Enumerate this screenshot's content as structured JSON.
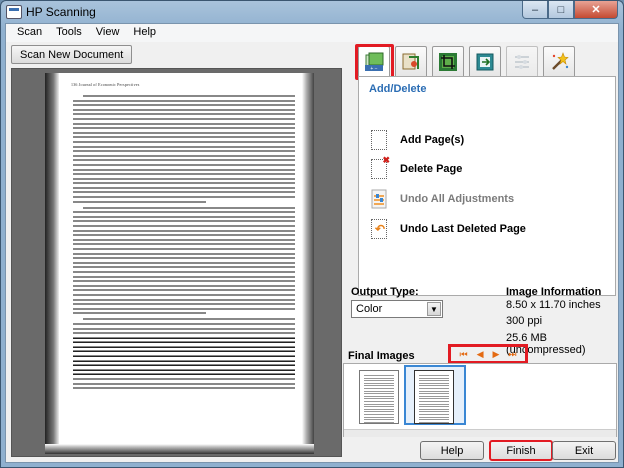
{
  "window": {
    "title": "HP Scanning",
    "minimize": "–",
    "maximize": "□",
    "close": "✕"
  },
  "menu": [
    "Scan",
    "Tools",
    "View",
    "Help"
  ],
  "scan_button": "Scan New Document",
  "preview": {
    "running_head": "136   Journal of Economic Perspectives"
  },
  "tabs": [
    {
      "icon": "add-delete-icon"
    },
    {
      "icon": "crop-rotate-icon"
    },
    {
      "icon": "crop-icon"
    },
    {
      "icon": "arrange-icon"
    },
    {
      "icon": "adjust-sliders-icon"
    },
    {
      "icon": "magic-wand-icon"
    }
  ],
  "task_panel": {
    "title": "Add/Delete",
    "tasks": [
      {
        "label": "Add Page(s)",
        "enabled": true
      },
      {
        "label": "Delete Page",
        "enabled": true
      },
      {
        "label": "Undo All Adjustments",
        "enabled": false
      },
      {
        "label": "Undo Last Deleted Page",
        "enabled": true
      }
    ]
  },
  "output_type": {
    "label": "Output Type:",
    "value": "Color"
  },
  "image_info": {
    "label": "Image Information",
    "size": "8.50 x 11.70 inches",
    "resolution": "300 ppi",
    "file_size": "25.6 MB (uncompressed)"
  },
  "final_images": {
    "label": "Final Images",
    "selected_index": 1,
    "count": 2
  },
  "nav": [
    "⏮",
    "◀",
    "▶",
    "⏭"
  ],
  "buttons": {
    "help": "Help",
    "finish": "Finish",
    "exit": "Exit"
  },
  "colors": {
    "highlight": "#e21b23",
    "accent": "#2b6db4",
    "nav_arrows": "#e46a12"
  }
}
